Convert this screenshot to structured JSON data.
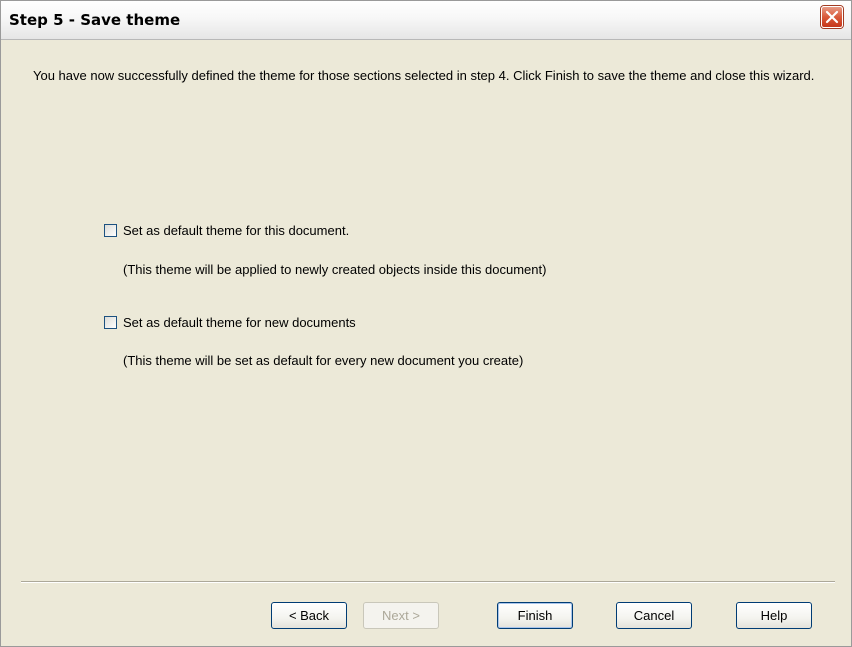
{
  "window": {
    "title": "Step 5 - Save theme",
    "close_icon": "close-icon",
    "close_color": "#D9593A"
  },
  "intro_text": "You have now successfully defined the theme for those sections selected in step 4. Click Finish to save the theme and close this wizard.",
  "options": [
    {
      "label": "Set as default theme for this document.",
      "note": "(This theme will be applied to newly created objects inside this document)",
      "checked": false
    },
    {
      "label": "Set as default theme for new documents",
      "note": "(This theme will be set as default for every new document you create)",
      "checked": false
    }
  ],
  "buttons": {
    "back": "< Back",
    "next": "Next >",
    "finish": "Finish",
    "cancel": "Cancel",
    "help": "Help"
  },
  "colors": {
    "dialog_bg": "#ECE9D8",
    "button_border": "#003C74",
    "disabled_text": "#ACA899"
  }
}
